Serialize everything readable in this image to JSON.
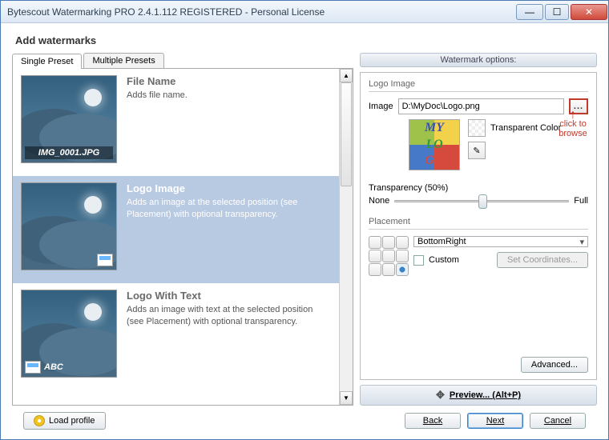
{
  "window": {
    "title": "Bytescout Watermarking PRO 2.4.1.112 REGISTERED - Personal License"
  },
  "page": {
    "heading": "Add watermarks"
  },
  "tabs": {
    "single": "Single Preset",
    "multiple": "Multiple Presets"
  },
  "presets": [
    {
      "title": "File Name",
      "desc": "Adds file name.",
      "caption": "IMG_0001.JPG"
    },
    {
      "title": "Logo Image",
      "desc": "Adds an image at the selected position (see Placement) with optional transparency."
    },
    {
      "title": "Logo With Text",
      "desc": "Adds an image with text at the selected position (see Placement) with optional transparency.",
      "badge_text": "ABC"
    }
  ],
  "options": {
    "header": "Watermark options:",
    "section_logo": "Logo Image",
    "image_label": "Image",
    "image_path": "D:\\MyDoc\\Logo.png",
    "browse": "...",
    "logo_lines": [
      "MY",
      "LO",
      "GO"
    ],
    "transparent_color": "Transparent Color",
    "transparency_label": "Transparency (50%)",
    "transparency_min": "None",
    "transparency_max": "Full",
    "placement_label": "Placement",
    "placement_value": "BottomRight",
    "custom_label": "Custom",
    "set_coords": "Set Coordinates...",
    "advanced": "Advanced...",
    "preview": "Preview... (Alt+P)"
  },
  "annotation": {
    "arrow": "↑",
    "text": "click to browse"
  },
  "footer": {
    "load_profile": "Load profile",
    "back": "Back",
    "next": "Next",
    "cancel": "Cancel"
  }
}
